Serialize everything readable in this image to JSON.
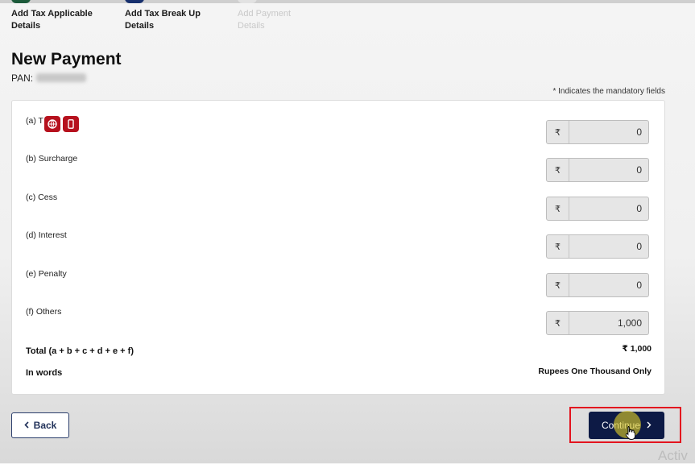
{
  "stepper": {
    "steps": [
      {
        "line1": "Add Tax Applicable",
        "line2": "Details",
        "state": "done"
      },
      {
        "line1": "Add Tax Break Up",
        "line2": "Details",
        "state": "current"
      },
      {
        "line1": "Add Payment",
        "line2": "Details",
        "state": "pending"
      }
    ]
  },
  "page": {
    "title": "New Payment",
    "pan_label": "PAN:",
    "mandatory_note": "* Indicates the mandatory fields"
  },
  "breakup": {
    "currency_symbol": "₹",
    "rows": [
      {
        "label": "(a) T",
        "value": "0"
      },
      {
        "label": "(b) Surcharge",
        "value": "0"
      },
      {
        "label": "(c) Cess",
        "value": "0"
      },
      {
        "label": "(d) Interest",
        "value": "0"
      },
      {
        "label": "(e) Penalty",
        "value": "0"
      },
      {
        "label": "(f) Others",
        "value": "1,000"
      }
    ],
    "total_label": "Total (a + b + c + d + e + f)",
    "total_value": "₹ 1,000",
    "words_label": "In words",
    "words_value": "Rupees One Thousand Only"
  },
  "overlay_icons": [
    "globe-icon",
    "mobile-icon"
  ],
  "actions": {
    "back_label": "Back",
    "continue_label": "Continue"
  },
  "watermark": "Activ",
  "colors": {
    "primary": "#0d1a45",
    "overlay_icon_bg": "#b6111d",
    "highlight": "#e3141f"
  }
}
